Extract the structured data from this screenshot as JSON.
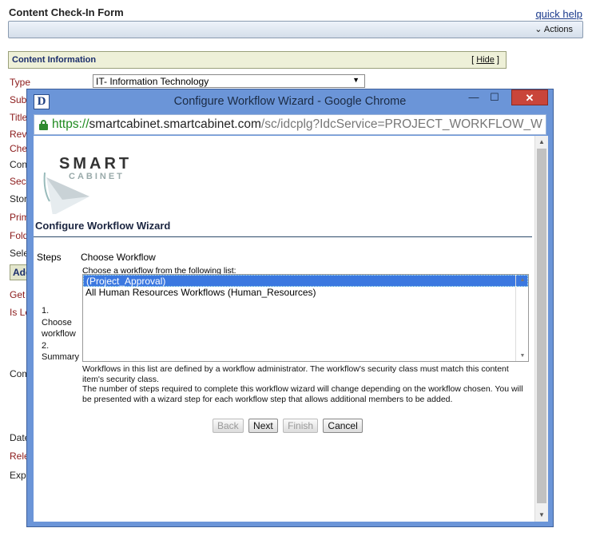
{
  "background": {
    "title": "Content Check-In Form",
    "quick_help": "quick help",
    "actions_label": "Actions",
    "section_title": "Content Information",
    "hide_link": "Hide",
    "type_value": "IT- Information Technology",
    "field_labels": [
      "Type",
      "Sub",
      "Title",
      "Revi",
      "Che",
      "Con",
      "Secu",
      "Stor",
      "Prim",
      "Fold",
      "Sele",
      "Add",
      "Get",
      "Is Le",
      "Com",
      "Date",
      "Rele",
      "Exp"
    ]
  },
  "popup": {
    "window_title": "Configure Workflow Wizard - Google Chrome",
    "app_icon_letter": "D",
    "url_protocol": "https://",
    "url_host": "smartcabinet.smartcabinet.com",
    "url_path": "/sc/idcplg?IdcService=PROJECT_WORKFLOW_W",
    "logo_smart": "SMART",
    "logo_cabinet": "CABINET",
    "wizard_title": "Configure Workflow Wizard",
    "steps_label": "Steps",
    "steps": [
      "1.",
      "Choose",
      "workflow",
      "2.",
      "Summary"
    ],
    "choose_title": "Choose Workflow",
    "choose_sub": "Choose a workflow from the following list:",
    "workflows": [
      {
        "label": "(Project_Approval)",
        "selected": true
      },
      {
        "label": "All Human Resources Workflows (Human_Resources)",
        "selected": false
      }
    ],
    "note1": "Workflows in this list are defined by a workflow administrator. The workflow's security class must match this content item's security class.",
    "note2": "The number of steps required to complete this workflow wizard will change depending on the workflow chosen. You will be presented with a wizard step for each workflow step that allows additional members to be added.",
    "buttons": {
      "back": "Back",
      "next": "Next",
      "finish": "Finish",
      "cancel": "Cancel"
    }
  },
  "colors": {
    "titlebar": "#6b95d8",
    "close": "#c9453a",
    "selected": "#3b78e0",
    "label_red": "#8b1a1a"
  }
}
